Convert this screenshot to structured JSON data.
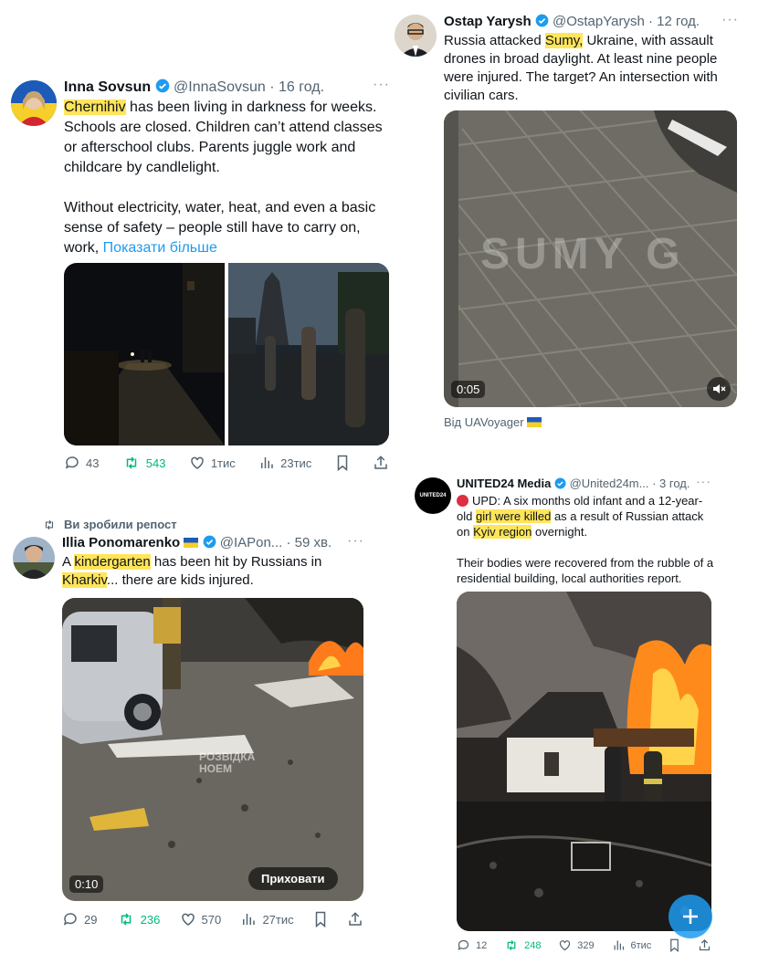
{
  "tweet1": {
    "name": "Inna Sovsun",
    "handle": "@InnaSovsun",
    "time": "· 16 год.",
    "text_hl": "Chernihiv",
    "text_1": " has been living in darkness for weeks. Schools are closed. Children can’t attend classes or afterschool clubs. Parents juggle work and childcare by candlelight.",
    "text_2": "Without electricity, water, heat, and even a basic sense of safety – people still have to carry on, work, ",
    "show_more": "Показати більше",
    "replies": "43",
    "reposts": "543",
    "likes": "1тис",
    "views": "23тис"
  },
  "tweet2": {
    "name": "Ostap Yarysh",
    "handle": "@OstapYarysh",
    "time": "· 12 год.",
    "text_a": "Russia attacked ",
    "text_hl": "Sumy,",
    "text_b": " Ukraine, with assault drones in broad daylight. At least nine people were injured. The target? An intersection with civilian cars.",
    "video_duration": "0:05",
    "watermark": "SUMY G",
    "source": "Від UAVoyager"
  },
  "tweet3": {
    "repost_label": "Ви зробили репост",
    "name": "Illia Ponomarenko",
    "handle": "@IAPon...",
    "time": "· 59 хв.",
    "text_a": "A ",
    "text_hl1": "kindergarten",
    "text_b": " has been hit by Russians in ",
    "text_hl2": "Kharkiv",
    "text_c": "... there are kids injured.",
    "video_duration": "0:10",
    "hide_label": "Приховати",
    "watermark_1": "РОЗВІДКА",
    "watermark_2": "НОЕМ",
    "replies": "29",
    "reposts": "236",
    "likes": "570",
    "views": "27тис"
  },
  "tweet4": {
    "name": "UNITED24 Media",
    "handle": "@United24m...",
    "time": "· 3 год.",
    "avatar_text": "UNITED24",
    "text_a": "UPD: A six months old infant and a 12-year-old ",
    "text_hl1": "girl were killed",
    "text_b": " as a result of Russian attack on ",
    "text_hl2": "Kyiv region",
    "text_c": " overnight.",
    "text_2": "Their bodies were recovered from the rubble of a residential building, local authorities report.",
    "replies": "12",
    "reposts": "248",
    "likes": "329",
    "views": "6тис"
  },
  "colors": {
    "highlight": "#ffe55a",
    "link": "#1d9bf0",
    "repost_green": "#00ba7c",
    "verified_blue": "#1d9bf0"
  }
}
